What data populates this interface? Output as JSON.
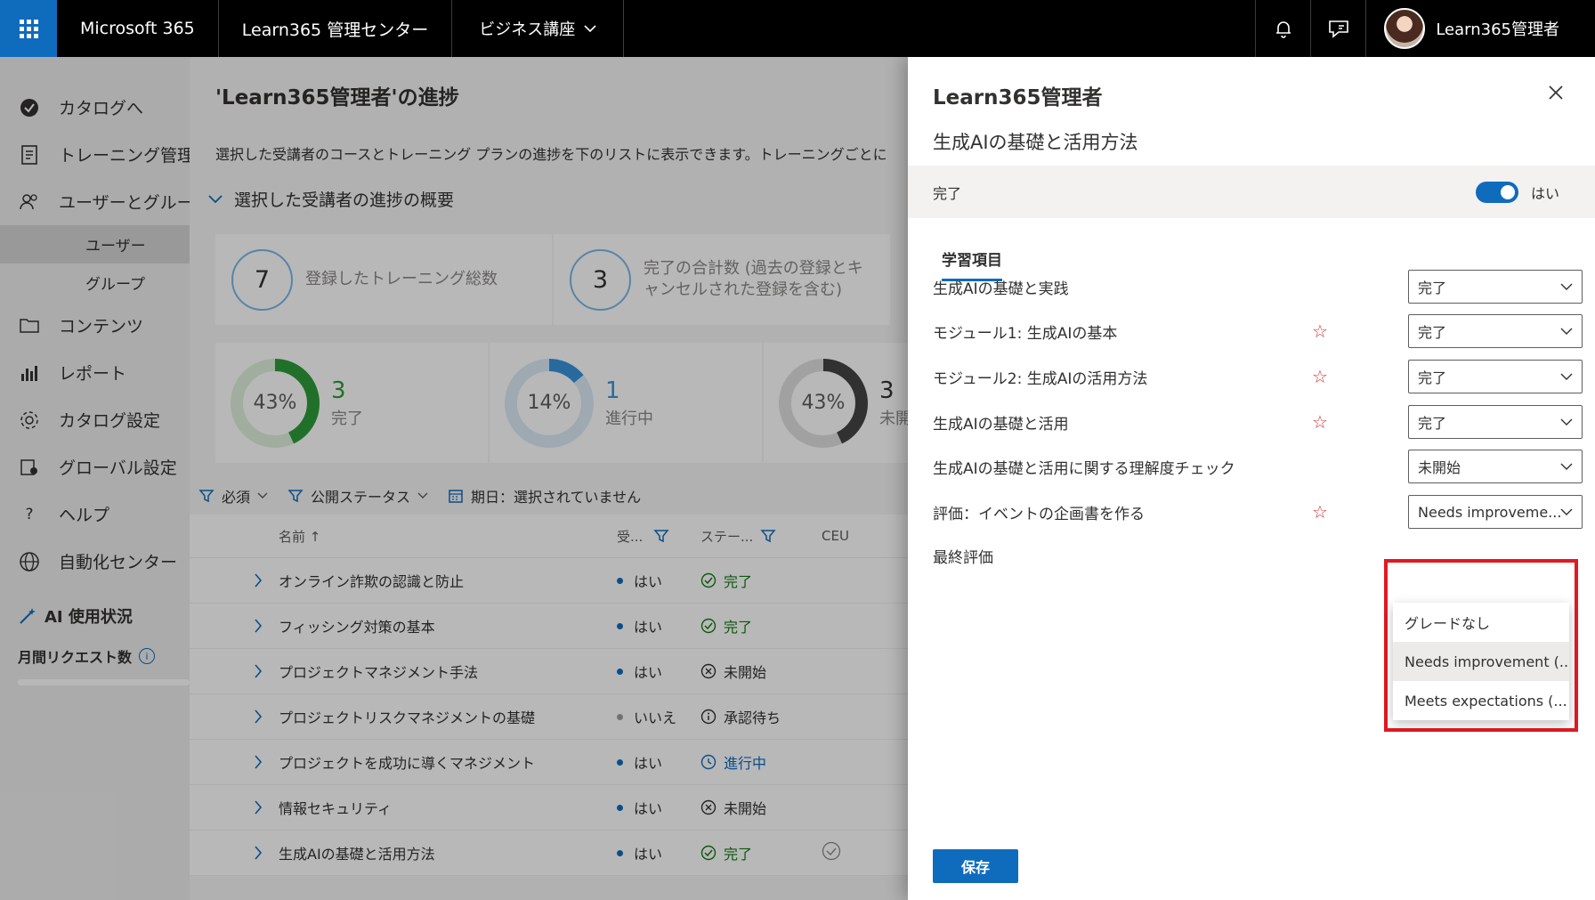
{
  "topbar": {
    "brand": "Microsoft 365",
    "center": "Learn365 管理センター",
    "org": "ビジネス講座",
    "user_name": "Learn365管理者"
  },
  "sidebar": {
    "items": [
      {
        "label": "カタログへ",
        "icon": "check-circle-icon"
      },
      {
        "label": "トレーニング管理",
        "icon": "clipboard-icon"
      },
      {
        "label": "ユーザーとグループ",
        "icon": "people-icon"
      }
    ],
    "sub_items": [
      {
        "label": "ユーザー",
        "active": true
      },
      {
        "label": "グループ",
        "active": false
      }
    ],
    "items2": [
      {
        "label": "コンテンツ",
        "icon": "folder-icon"
      },
      {
        "label": "レポート",
        "icon": "bar-chart-icon"
      },
      {
        "label": "カタログ設定",
        "icon": "gear-icon"
      },
      {
        "label": "グローバル設定",
        "icon": "globe-settings-icon"
      },
      {
        "label": "ヘルプ",
        "icon": "question-icon"
      },
      {
        "label": "自動化センター",
        "icon": "globe-icon"
      }
    ],
    "ai_title": "AI 使用状況",
    "ai_sub": "月間リクエスト数"
  },
  "main": {
    "title": "'Learn365管理者'の進捗",
    "description": "選択した受講者のコースとトレーニング プランの進捗を下のリストに表示できます。トレーニングごとに",
    "summary_header": "選択した受講者の進捗の概要",
    "cards": [
      {
        "number": "7",
        "label": "登録したトレーニング総数"
      },
      {
        "number": "3",
        "label_line1": "完了の合計数 (過去の登録とキ",
        "label_line2": "ャンセルされた登録を含む)"
      }
    ],
    "donuts": [
      {
        "pct_label": "43%",
        "fraction": 0.43,
        "count": "3",
        "label": "完了",
        "color": "#2e9b3a",
        "track": "#dff0dc"
      },
      {
        "pct_label": "14%",
        "fraction": 0.14,
        "count": "1",
        "label": "進行中",
        "color": "#3a94dc",
        "track": "#dbeaf7"
      },
      {
        "pct_label": "43%",
        "fraction": 0.43,
        "count": "3",
        "label": "未開始",
        "color": "#444444",
        "track": "#e0e0e0"
      }
    ],
    "filters": {
      "required": "必須",
      "publish_status": "公開ステータス",
      "due_date": "期日：選択されていません"
    },
    "table": {
      "headers": {
        "name": "名前",
        "required": "受...",
        "status": "ステー...",
        "ceu": "CEU"
      },
      "rows": [
        {
          "name": "オンライン詐欺の認識と防止",
          "required": "はい",
          "status": "完了",
          "kind": "done"
        },
        {
          "name": "フィッシング対策の基本",
          "required": "はい",
          "status": "完了",
          "kind": "done"
        },
        {
          "name": "プロジェクトマネジメント手法",
          "required": "はい",
          "status": "未開始",
          "kind": "not"
        },
        {
          "name": "プロジェクトリスクマネジメントの基礎",
          "required": "いいえ",
          "status": "承認待ち",
          "kind": "pending"
        },
        {
          "name": "プロジェクトを成功に導くマネジメント",
          "required": "はい",
          "status": "進行中",
          "kind": "prog"
        },
        {
          "name": "情報セキュリティ",
          "required": "はい",
          "status": "未開始",
          "kind": "not"
        },
        {
          "name": "生成AIの基礎と活用方法",
          "required": "はい",
          "status": "完了",
          "kind": "done"
        }
      ]
    }
  },
  "panel": {
    "title": "Learn365管理者",
    "subtitle": "生成AIの基礎と活用方法",
    "complete_label": "完了",
    "toggle_label": "はい",
    "tab": "学習項目",
    "rows": [
      {
        "label": "生成AIの基礎と実践",
        "required": false,
        "value": "完了"
      },
      {
        "label": "モジュール1: 生成AIの基本",
        "required": true,
        "value": "完了"
      },
      {
        "label": "モジュール2: 生成AIの活用方法",
        "required": true,
        "value": "完了"
      },
      {
        "label": "生成AIの基礎と活用",
        "required": true,
        "value": "完了"
      },
      {
        "label": "生成AIの基礎と活用に関する理解度チェック",
        "required": false,
        "value": "未開始"
      },
      {
        "label": "評価：イベントの企画書を作る",
        "required": true,
        "value": "Needs improveme..."
      }
    ],
    "final_label": "最終評価",
    "dropdown_options": [
      "グレードなし",
      "Needs improvement (...",
      "Meets expectations (..."
    ],
    "save": "保存"
  }
}
